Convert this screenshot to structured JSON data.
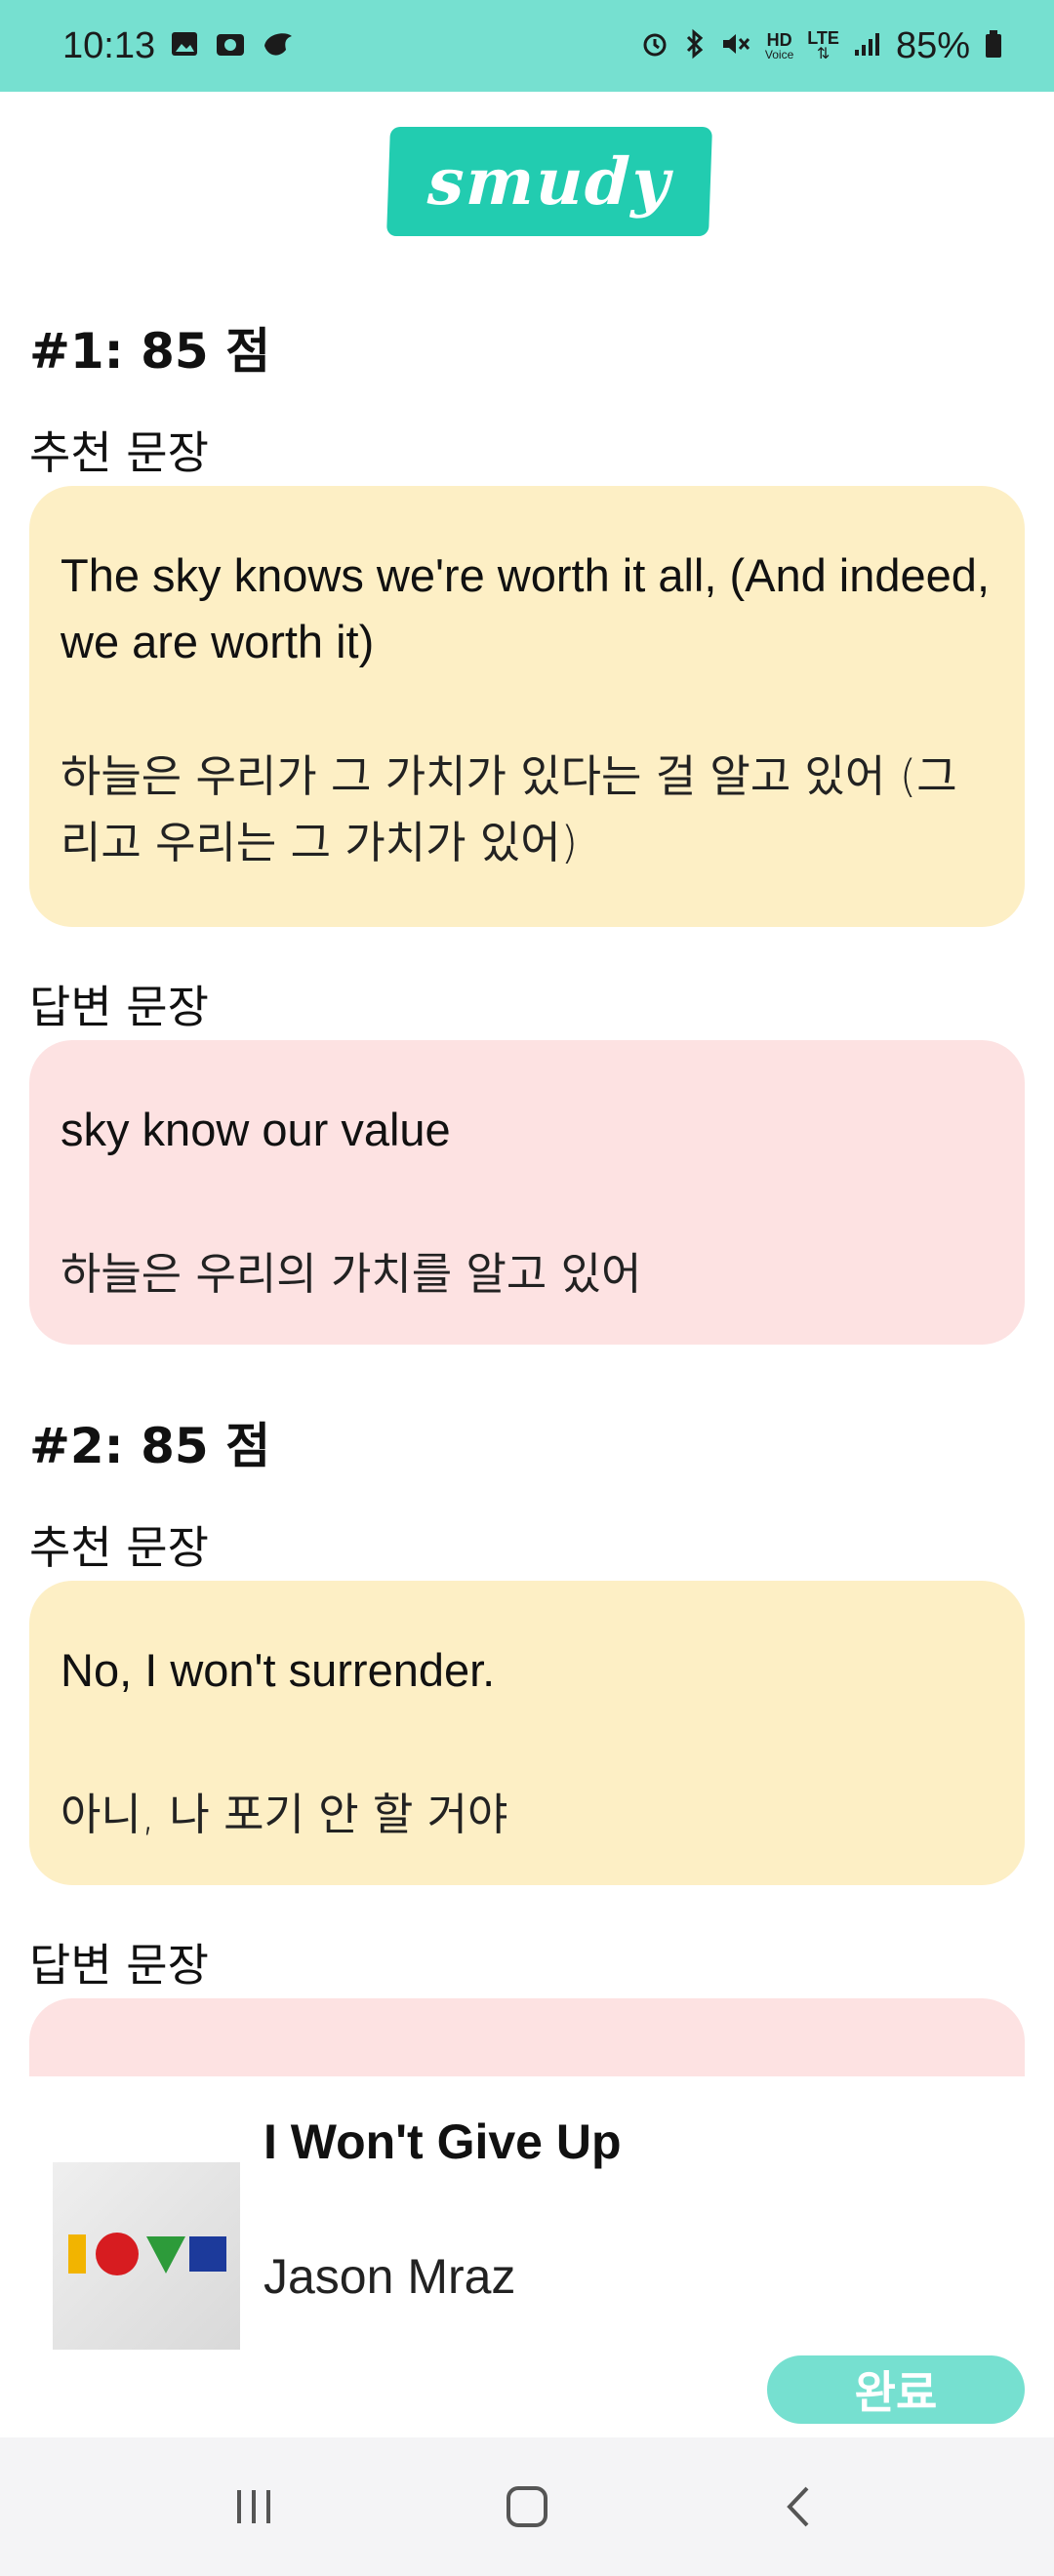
{
  "status_bar": {
    "time": "10:13",
    "battery": "85%",
    "hd_label": "HD",
    "voice_label": "Voice",
    "lte_label": "LTE"
  },
  "app": {
    "logo": "smudy"
  },
  "results": [
    {
      "score_title": "#1: 85 점",
      "recommended_label": "추천 문장",
      "recommended_en": "The sky knows we're worth it all, (And indeed, we are worth it)",
      "recommended_ko": "하늘은 우리가 그 가치가 있다는 걸 알고 있어 (그리고 우리는 그 가치가 있어)",
      "answer_label": "답변 문장",
      "answer_en": "sky know our value",
      "answer_ko": "하늘은 우리의 가치를 알고 있어"
    },
    {
      "score_title": "#2: 85 점",
      "recommended_label": "추천 문장",
      "recommended_en": "No, I won't surrender.",
      "recommended_ko": "아니, 나 포기 안 할 거야",
      "answer_label": "답변 문장",
      "answer_en": "",
      "answer_ko": ""
    }
  ],
  "player": {
    "song_title": "I Won't Give Up",
    "artist": "Jason Mraz",
    "done_label": "완료"
  },
  "colors": {
    "accent": "#76e0d0",
    "logo_bg": "#22ccb0",
    "recommended_bg": "#fdefc5",
    "answer_bg": "#fde2e2"
  },
  "icons": [
    "image-icon",
    "cloud-icon",
    "bird-icon",
    "alarm-icon",
    "bluetooth-icon",
    "mute-icon",
    "signal-icon",
    "battery-icon",
    "recents-icon",
    "home-icon",
    "back-icon"
  ]
}
